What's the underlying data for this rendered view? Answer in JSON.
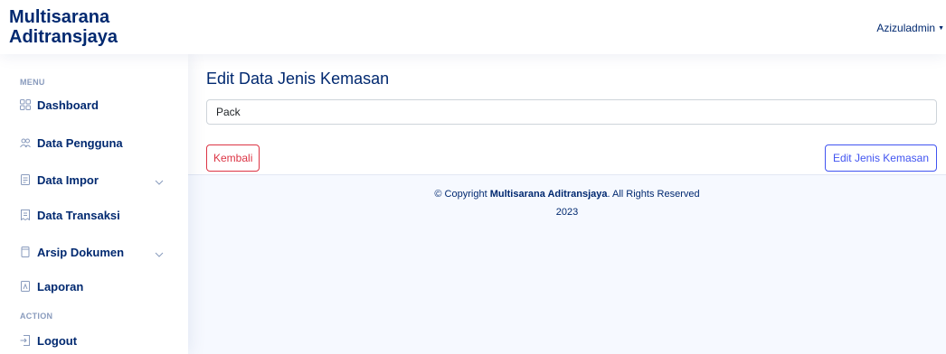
{
  "header": {
    "brand_line1": "Multisarana",
    "brand_line2": "Aditransjaya",
    "user_name": "Azizuladmin"
  },
  "sidebar": {
    "menu_heading": "MENU",
    "action_heading": "ACTION",
    "items": [
      {
        "label": "Dashboard",
        "icon": "grid-icon"
      },
      {
        "label": "Data Pengguna",
        "icon": "people-icon"
      },
      {
        "label": "Data Impor",
        "icon": "file-icon",
        "has_submenu": true
      },
      {
        "label": "Data Transaksi",
        "icon": "receipt-icon"
      },
      {
        "label": "Arsip Dokumen",
        "icon": "archive-icon",
        "has_submenu": true
      },
      {
        "label": "Laporan",
        "icon": "pdf-icon"
      },
      {
        "label": "Logout",
        "icon": "logout-icon"
      }
    ]
  },
  "form": {
    "title": "Edit Data Jenis Kemasan",
    "input_value": "Pack",
    "back_label": "Kembali",
    "submit_label": "Edit Jenis Kemasan"
  },
  "footer": {
    "copyright_prefix": "© Copyright ",
    "company": "Multisarana Aditransjaya",
    "copyright_suffix": ". All Rights Reserved",
    "year": "2023"
  },
  "colors": {
    "primary": "#4154f1",
    "navy": "#012970",
    "danger": "#dc3545",
    "background": "#f6f9ff"
  }
}
